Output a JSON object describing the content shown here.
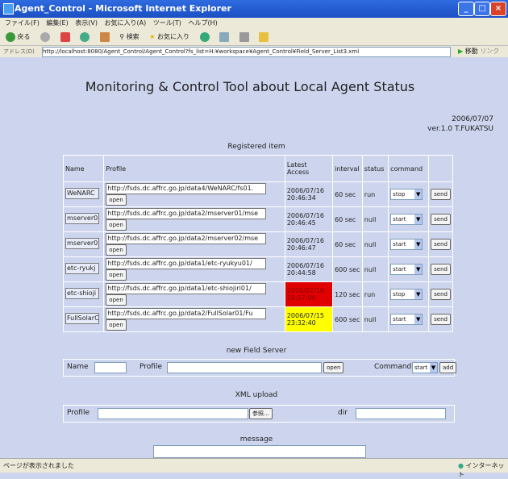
{
  "window": {
    "title": "Agent_Control - Microsoft Internet Explorer",
    "min": "_",
    "max": "□",
    "close": "×"
  },
  "menu": [
    "ファイル(F)",
    "編集(E)",
    "表示(V)",
    "お気に入り(A)",
    "ツール(T)",
    "ヘルプ(H)"
  ],
  "toolbar": {
    "back": "戻る",
    "search": "検索",
    "favorites": "お気に入り"
  },
  "address": {
    "label": "アドレス(D)",
    "url": "http://localhost:8080/Agent_Control/Agent_Control?fs_list=H:¥workspace¥Agent_Control¥Field_Server_List3.xml",
    "go": "移動",
    "links": "リンク"
  },
  "page": {
    "title": "Monitoring & Control Tool about Local Agent Status",
    "date": "2006/07/07",
    "version": "ver.1.0 T.FUKATSU"
  },
  "registered": {
    "heading": "Registered item",
    "columns": {
      "name": "Name",
      "profile": "Profile",
      "latest": "Latest Access",
      "interval": "interval",
      "status": "status",
      "command": "command"
    },
    "open_label": "open",
    "send_label": "send",
    "rows": [
      {
        "name": "WeNARC",
        "profile": "http://fsds.dc.affrc.go.jp/data4/WeNARC/fs01.",
        "access": "2006/07/16 20:46:34",
        "interval": "60 sec",
        "status": "run",
        "command": "stop",
        "state": "ok"
      },
      {
        "name": "mserver0",
        "profile": "http://fsds.dc.affrc.go.jp/data2/mserver01/mse",
        "access": "2006/07/16 20:46:45",
        "interval": "60 sec",
        "status": "null",
        "command": "start",
        "state": "ok"
      },
      {
        "name": "mserver0",
        "profile": "http://fsds.dc.affrc.go.jp/data2/mserver02/mse",
        "access": "2006/07/16 20:46:47",
        "interval": "60 sec",
        "status": "null",
        "command": "start",
        "state": "ok"
      },
      {
        "name": "etc-ryukj",
        "profile": "http://fsds.dc.affrc.go.jp/data1/etc-ryukyu01/",
        "access": "2006/07/16 20:44:58",
        "interval": "600 sec",
        "status": "null",
        "command": "start",
        "state": "ok"
      },
      {
        "name": "etc-shioji",
        "profile": "http://fsds.dc.affrc.go.jp/data1/etc-shiojiri01/",
        "access": "2006/07/16 19:57:00",
        "interval": "120 sec",
        "status": "run",
        "command": "stop",
        "state": "error"
      },
      {
        "name": "FullSolarC",
        "profile": "http://fsds.dc.affrc.go.jp/data2/FullSolar01/Fu",
        "access": "2006/07/15 23:32:40",
        "interval": "600 sec",
        "status": "null",
        "command": "start",
        "state": "warn"
      }
    ]
  },
  "new_field_server": {
    "heading": "new Field Server",
    "name_label": "Name",
    "profile_label": "Profile",
    "open_label": "open",
    "command_label": "Command",
    "command_value": "start",
    "add_label": "add"
  },
  "xml_upload": {
    "heading": "XML upload",
    "profile_label": "Profile",
    "browse_label": "参照...",
    "dir_label": "dir"
  },
  "message": {
    "heading": "message"
  },
  "status": {
    "text": "ページが表示されました",
    "zone": "インターネット"
  },
  "colors": {
    "error": "#e00000",
    "warn": "#ffff00",
    "bg": "#cdd5ee"
  }
}
